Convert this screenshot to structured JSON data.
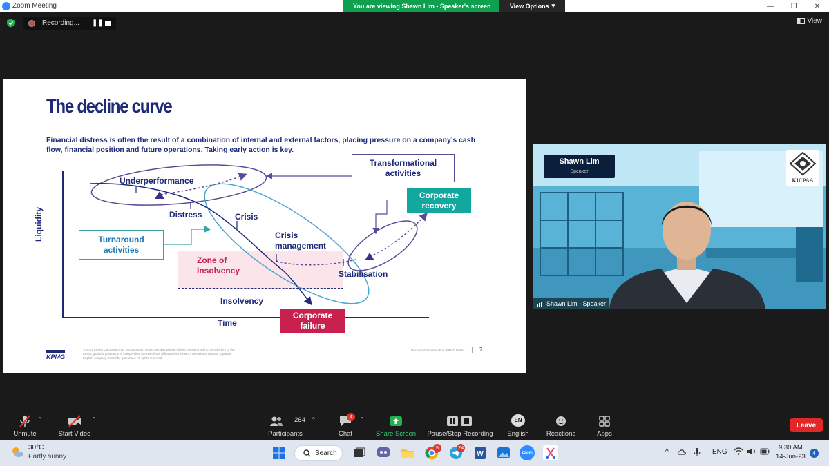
{
  "window": {
    "title": "Zoom Meeting",
    "banner_text": "You are viewing Shawn Lim - Speaker's screen",
    "view_options_label": "View Options"
  },
  "topbar": {
    "recording_label": "Recording...",
    "view_label": "View"
  },
  "slide": {
    "title": "The decline curve",
    "subtitle": "Financial distress is often the result of a combination of internal and external factors, placing pressure on a company’s cash flow, financial position and future operations. Taking early action is key.",
    "labels": {
      "underperformance": "Underperformance",
      "distress": "Distress",
      "crisis": "Crisis",
      "crisis_management": "Crisis management",
      "zone_of_insolvency": "Zone of Insolvency",
      "insolvency": "Insolvency",
      "stabilisation": "Stabilisation",
      "liquidity": "Liquidity",
      "time": "Time"
    },
    "boxes": {
      "transformational": "Transformational activities",
      "corporate_recovery": "Corporate recovery",
      "turnaround": "Turnaround activities",
      "corporate_failure": "Corporate failure"
    },
    "footer": {
      "logo_text": "KPMG",
      "fine_print": "© 2023 KPMG Cambodia Ltd., a Cambodian single member private limited company and a member firm of the KPMG global organization of independent member firms affiliated with KPMG International Limited, a private English company limited by guarantee. All rights reserved.",
      "classification": "Document Classification: KPMG Public",
      "page_number": "7"
    },
    "colors": {
      "navy": "#1e2a78",
      "purple": "#5a4b96",
      "teal": "#13a89e",
      "red": "#c8214d",
      "pink": "#fbe4ea"
    }
  },
  "speaker": {
    "name": "Shawn Lim",
    "role": "Speaker",
    "caption": "Shawn Lim - Speaker",
    "logo_text": "KICPAA"
  },
  "toolbar": {
    "unmute": "Unmute",
    "start_video": "Start Video",
    "participants_count": "264",
    "participants": "Participants",
    "chat": "Chat",
    "chat_badge": "4",
    "share_screen": "Share Screen",
    "pause_stop_recording": "Pause/Stop Recording",
    "language_code": "EN",
    "language": "English",
    "reactions": "Reactions",
    "apps": "Apps",
    "leave": "Leave"
  },
  "taskbar": {
    "temperature": "30°C",
    "weather": "Partly sunny",
    "search": "Search",
    "chrome_badge": "5",
    "telegram_badge": "24",
    "zoom_label": "zoom",
    "lang": "ENG",
    "time": "9:30 AM",
    "date": "14-Jun-23",
    "notifications": "4"
  }
}
